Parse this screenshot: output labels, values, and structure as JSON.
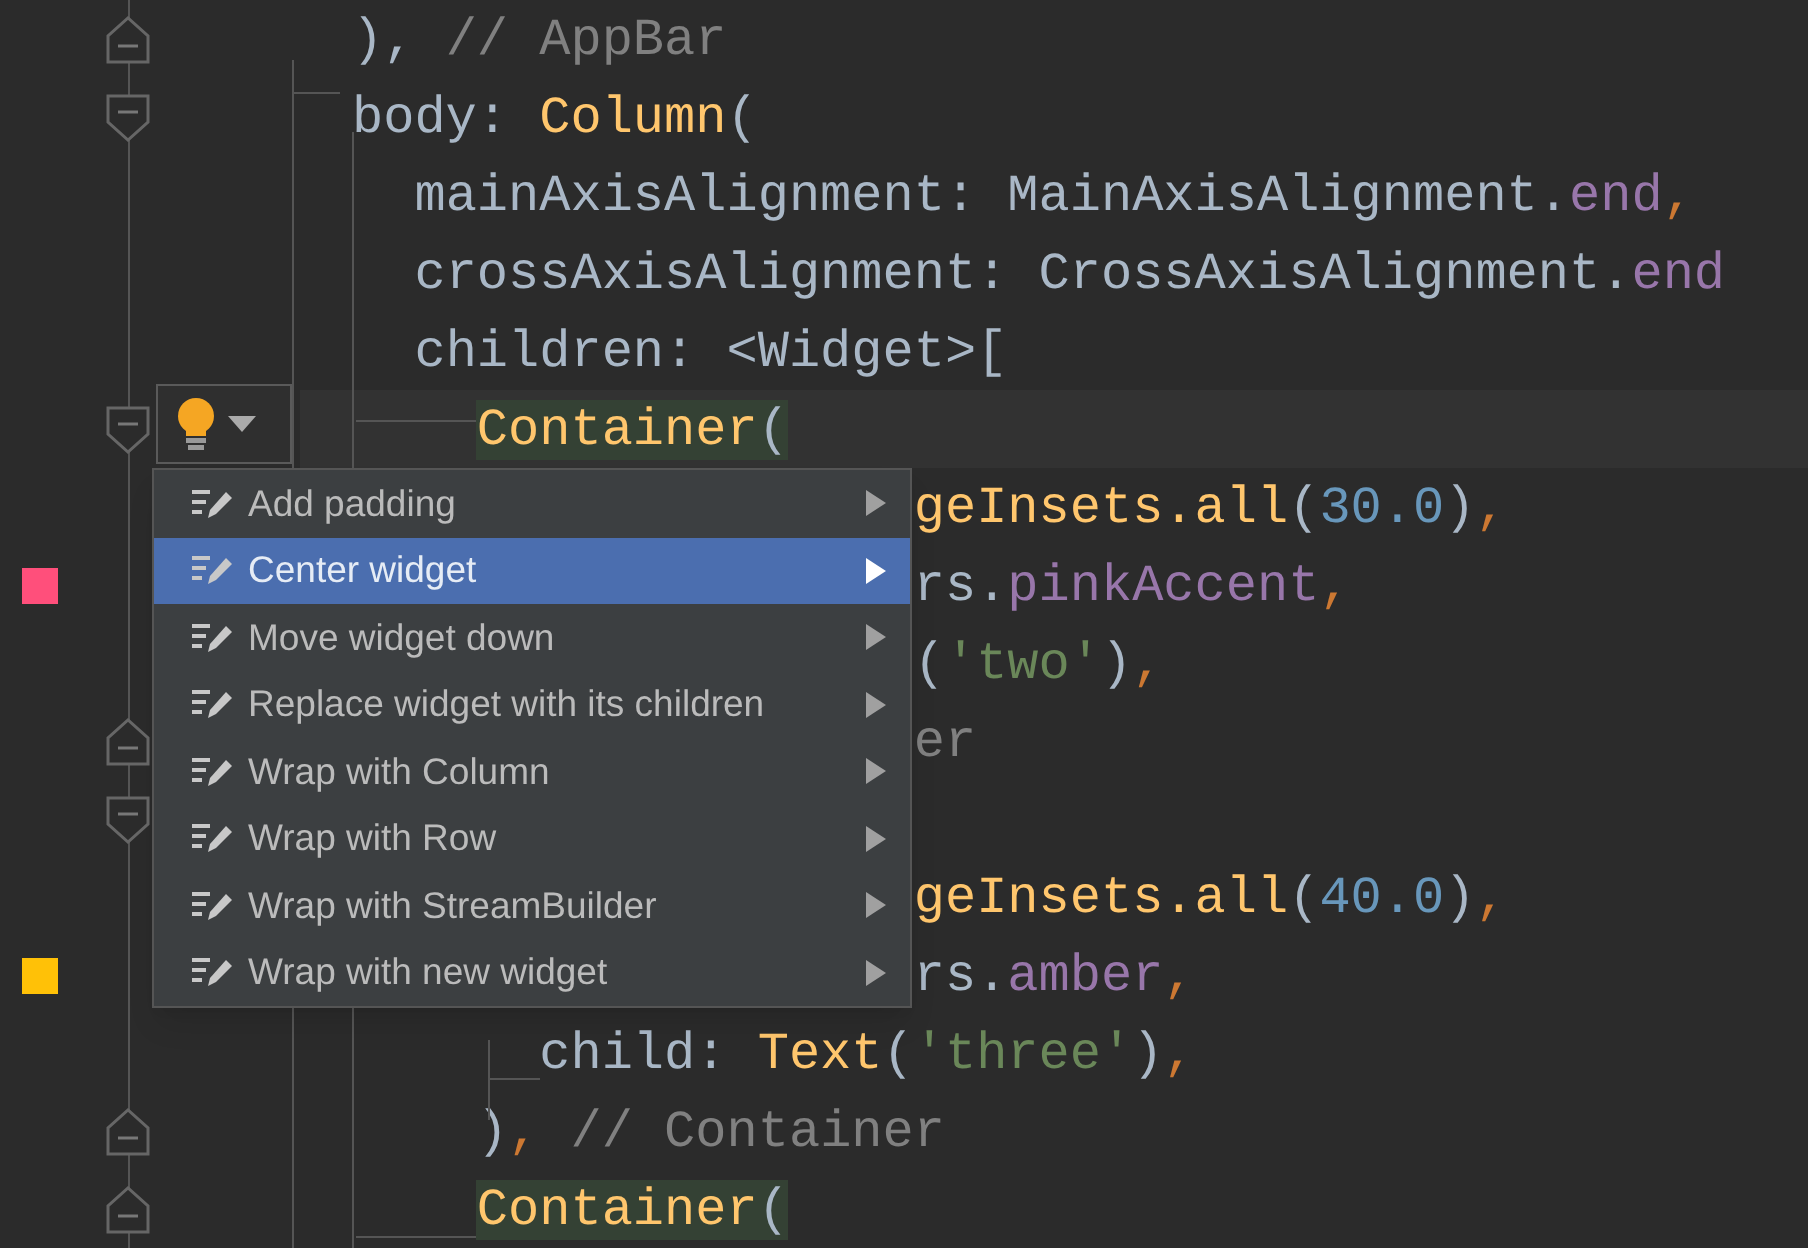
{
  "editor": {
    "lines": [
      {
        "fold_close": true,
        "tokens": [
          {
            "kind": "plain",
            "text": "), "
          },
          {
            "kind": "comment",
            "text": "// AppBar"
          }
        ]
      },
      {
        "fold_open": true,
        "tokens": [
          {
            "kind": "plain",
            "text": "body: "
          },
          {
            "kind": "class",
            "text": "Column"
          },
          {
            "kind": "plain",
            "text": "("
          }
        ]
      },
      {
        "tokens": [
          {
            "kind": "plain",
            "text": "  mainAxisAlignment: MainAxisAlignment."
          },
          {
            "kind": "member",
            "text": "end"
          },
          {
            "kind": "punct",
            "text": ","
          }
        ]
      },
      {
        "tokens": [
          {
            "kind": "plain",
            "text": "  crossAxisAlignment: CrossAxisAlignment."
          },
          {
            "kind": "member",
            "text": "end"
          }
        ]
      },
      {
        "tokens": [
          {
            "kind": "plain",
            "text": "  children: <Widget>["
          }
        ]
      },
      {
        "fold_open": true,
        "current": true,
        "tokens": [
          {
            "kind": "class",
            "text": "    Container",
            "highlight": true
          },
          {
            "kind": "plain",
            "text": "(",
            "highlight": true
          }
        ]
      },
      {
        "tokens": [
          {
            "kind": "class",
            "text": "                  geInsets.all"
          },
          {
            "kind": "plain",
            "text": "("
          },
          {
            "kind": "number",
            "text": "30.0"
          },
          {
            "kind": "plain",
            "text": ")"
          },
          {
            "kind": "punct",
            "text": ","
          }
        ]
      },
      {
        "color": "#ff4f7b",
        "tokens": [
          {
            "kind": "plain",
            "text": "                  rs."
          },
          {
            "kind": "member",
            "text": "pinkAccent"
          },
          {
            "kind": "punct",
            "text": ","
          }
        ]
      },
      {
        "tokens": [
          {
            "kind": "plain",
            "text": "                  ("
          },
          {
            "kind": "string",
            "text": "'two'"
          },
          {
            "kind": "plain",
            "text": ")"
          },
          {
            "kind": "punct",
            "text": ","
          }
        ]
      },
      {
        "fold_close": true,
        "tokens": [
          {
            "kind": "comment",
            "text": "                  er"
          }
        ]
      },
      {
        "fold_open": true
      },
      {
        "tokens": [
          {
            "kind": "class",
            "text": "                  geInsets.all"
          },
          {
            "kind": "plain",
            "text": "("
          },
          {
            "kind": "number",
            "text": "40.0"
          },
          {
            "kind": "plain",
            "text": ")"
          },
          {
            "kind": "punct",
            "text": ","
          }
        ]
      },
      {
        "color": "#ffc107",
        "tokens": [
          {
            "kind": "plain",
            "text": "                  rs."
          },
          {
            "kind": "member",
            "text": "amber"
          },
          {
            "kind": "punct",
            "text": ","
          }
        ]
      },
      {
        "tokens": [
          {
            "kind": "plain",
            "text": "      child: "
          },
          {
            "kind": "class",
            "text": "Text"
          },
          {
            "kind": "plain",
            "text": "("
          },
          {
            "kind": "string",
            "text": "'three'"
          },
          {
            "kind": "plain",
            "text": ")"
          },
          {
            "kind": "punct",
            "text": ","
          }
        ]
      },
      {
        "fold_close": true,
        "tokens": [
          {
            "kind": "plain",
            "text": "    )"
          },
          {
            "kind": "punct",
            "text": ", "
          },
          {
            "kind": "comment",
            "text": "// Container"
          }
        ]
      },
      {
        "fold_close": true,
        "tokens": [
          {
            "kind": "class",
            "text": "    Container",
            "highlight": true
          },
          {
            "kind": "plain",
            "text": "(",
            "highlight": true
          }
        ]
      }
    ]
  },
  "intention_menu": {
    "items": [
      {
        "label": "Add padding",
        "selected": false,
        "submenu": true
      },
      {
        "label": "Center widget",
        "selected": true,
        "submenu": true
      },
      {
        "label": "Move widget down",
        "selected": false,
        "submenu": true
      },
      {
        "label": "Replace widget with its children",
        "selected": false,
        "submenu": true
      },
      {
        "label": "Wrap with Column",
        "selected": false,
        "submenu": true
      },
      {
        "label": "Wrap with Row",
        "selected": false,
        "submenu": true
      },
      {
        "label": "Wrap with StreamBuilder",
        "selected": false,
        "submenu": true
      },
      {
        "label": "Wrap with new widget",
        "selected": false,
        "submenu": true
      }
    ]
  }
}
